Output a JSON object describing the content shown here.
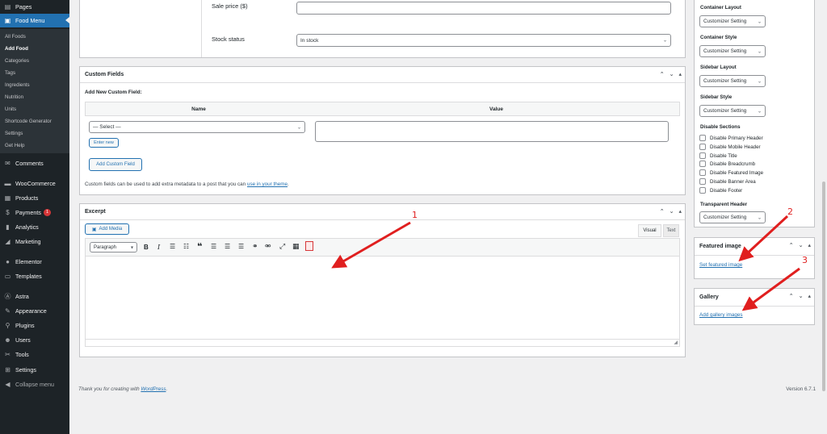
{
  "sidebar": {
    "top": {
      "label": "Pages",
      "icon": "pages-icon"
    },
    "active": {
      "label": "Food Menu",
      "icon": "food-menu-icon"
    },
    "submenu": [
      "All Foods",
      "Add Food",
      "Categories",
      "Tags",
      "Ingredients",
      "Nutrition",
      "Units",
      "Shortcode Generator",
      "Settings",
      "Get Help"
    ],
    "current_sub": "Add Food",
    "items": [
      {
        "label": "Comments",
        "icon": "comments-icon"
      },
      {
        "label": "WooCommerce",
        "icon": "woocommerce-icon"
      },
      {
        "label": "Products",
        "icon": "products-icon"
      },
      {
        "label": "Payments",
        "icon": "payments-icon",
        "badge": "1"
      },
      {
        "label": "Analytics",
        "icon": "analytics-icon"
      },
      {
        "label": "Marketing",
        "icon": "marketing-icon"
      },
      {
        "label": "Elementor",
        "icon": "elementor-icon"
      },
      {
        "label": "Templates",
        "icon": "templates-icon"
      },
      {
        "label": "Astra",
        "icon": "astra-icon"
      },
      {
        "label": "Appearance",
        "icon": "appearance-icon"
      },
      {
        "label": "Plugins",
        "icon": "plugins-icon"
      },
      {
        "label": "Users",
        "icon": "users-icon"
      },
      {
        "label": "Tools",
        "icon": "tools-icon"
      },
      {
        "label": "Settings",
        "icon": "settings-icon"
      },
      {
        "label": "Collapse menu",
        "icon": "collapse-icon"
      }
    ]
  },
  "pricing": {
    "sale_price_label": "Sale price ($)",
    "sale_price_value": "",
    "stock_status_label": "Stock status",
    "stock_status_value": "In stock"
  },
  "custom_fields": {
    "title": "Custom Fields",
    "add_new_label": "Add New Custom Field:",
    "col_name": "Name",
    "col_value": "Value",
    "select_value": "— Select —",
    "enter_new": "Enter new",
    "add_button": "Add Custom Field",
    "help_text": "Custom fields can be used to add extra metadata to a post that you can",
    "help_link": "use in your theme",
    "help_end": "."
  },
  "excerpt": {
    "title": "Excerpt",
    "add_media": "Add Media",
    "tab_visual": "Visual",
    "tab_text": "Text",
    "format_value": "Paragraph"
  },
  "right": {
    "container_layout_label": "Container Layout",
    "container_layout_value": "Customizer Setting",
    "container_style_label": "Container Style",
    "container_style_value": "Customizer Setting",
    "sidebar_layout_label": "Sidebar Layout",
    "sidebar_layout_value": "Customizer Setting",
    "sidebar_style_label": "Sidebar Style",
    "sidebar_style_value": "Customizer Setting",
    "disable_sections_label": "Disable Sections",
    "disable_options": [
      "Disable Primary Header",
      "Disable Mobile Header",
      "Disable Title",
      "Disable Breadcrumb",
      "Disable Featured Image",
      "Disable Banner Area",
      "Disable Footer"
    ],
    "transparent_header_label": "Transparent Header",
    "transparent_header_value": "Customizer Setting",
    "featured_title": "Featured image",
    "featured_link": "Set featured image",
    "gallery_title": "Gallery",
    "gallery_link": "Add gallery images"
  },
  "footer": {
    "thanks": "Thank you for creating with",
    "wp_link": "WordPress",
    "thanks_end": ".",
    "version": "Version 6.7.1"
  },
  "annotations": [
    "1",
    "2",
    "3"
  ],
  "colors": {
    "accent": "#2271b1",
    "sidebar": "#1d2327",
    "arrow": "#e01f1f"
  }
}
